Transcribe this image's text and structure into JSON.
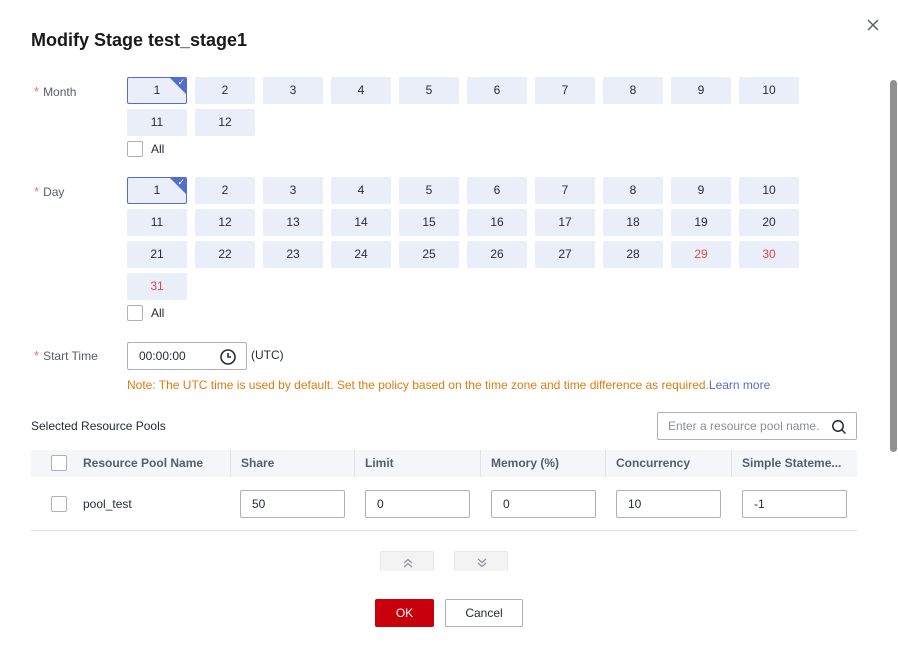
{
  "dialog": {
    "title": "Modify Stage test_stage1",
    "close_icon": "close-icon"
  },
  "month": {
    "label": "Month",
    "required_mark": "*",
    "options": [
      "1",
      "2",
      "3",
      "4",
      "5",
      "6",
      "7",
      "8",
      "9",
      "10",
      "11",
      "12"
    ],
    "selected": [
      "1"
    ],
    "all_label": "All",
    "all_checked": false
  },
  "day": {
    "label": "Day",
    "required_mark": "*",
    "options": [
      "1",
      "2",
      "3",
      "4",
      "5",
      "6",
      "7",
      "8",
      "9",
      "10",
      "11",
      "12",
      "13",
      "14",
      "15",
      "16",
      "17",
      "18",
      "19",
      "20",
      "21",
      "22",
      "23",
      "24",
      "25",
      "26",
      "27",
      "28",
      "29",
      "30",
      "31"
    ],
    "highlighted": [
      "29",
      "30",
      "31"
    ],
    "selected": [
      "1"
    ],
    "all_label": "All",
    "all_checked": false
  },
  "start_time": {
    "label": "Start Time",
    "required_mark": "*",
    "value": "00:00:00",
    "suffix": "(UTC)",
    "note": "Note: The UTC time is used by default. Set the policy based on the time zone and time difference as required.",
    "learn_more": "Learn more"
  },
  "resource_pools": {
    "title": "Selected Resource Pools",
    "search_placeholder": "Enter a resource pool name.",
    "columns": [
      "Resource Pool Name",
      "Share",
      "Limit",
      "Memory (%)",
      "Concurrency",
      "Simple Stateme..."
    ],
    "rows": [
      {
        "name": "pool_test",
        "share": "50",
        "limit": "0",
        "memory": "0",
        "concurrency": "10",
        "simple_statement": "-1",
        "checked": false
      }
    ]
  },
  "footer": {
    "ok_label": "OK",
    "cancel_label": "Cancel"
  },
  "colors": {
    "primary_button": "#c7000b",
    "selected_border": "#526ecc",
    "chip_bg": "#eaeef8",
    "weekend_text": "#e54545",
    "note_text": "#e27a0e",
    "link": "#526ecc"
  }
}
